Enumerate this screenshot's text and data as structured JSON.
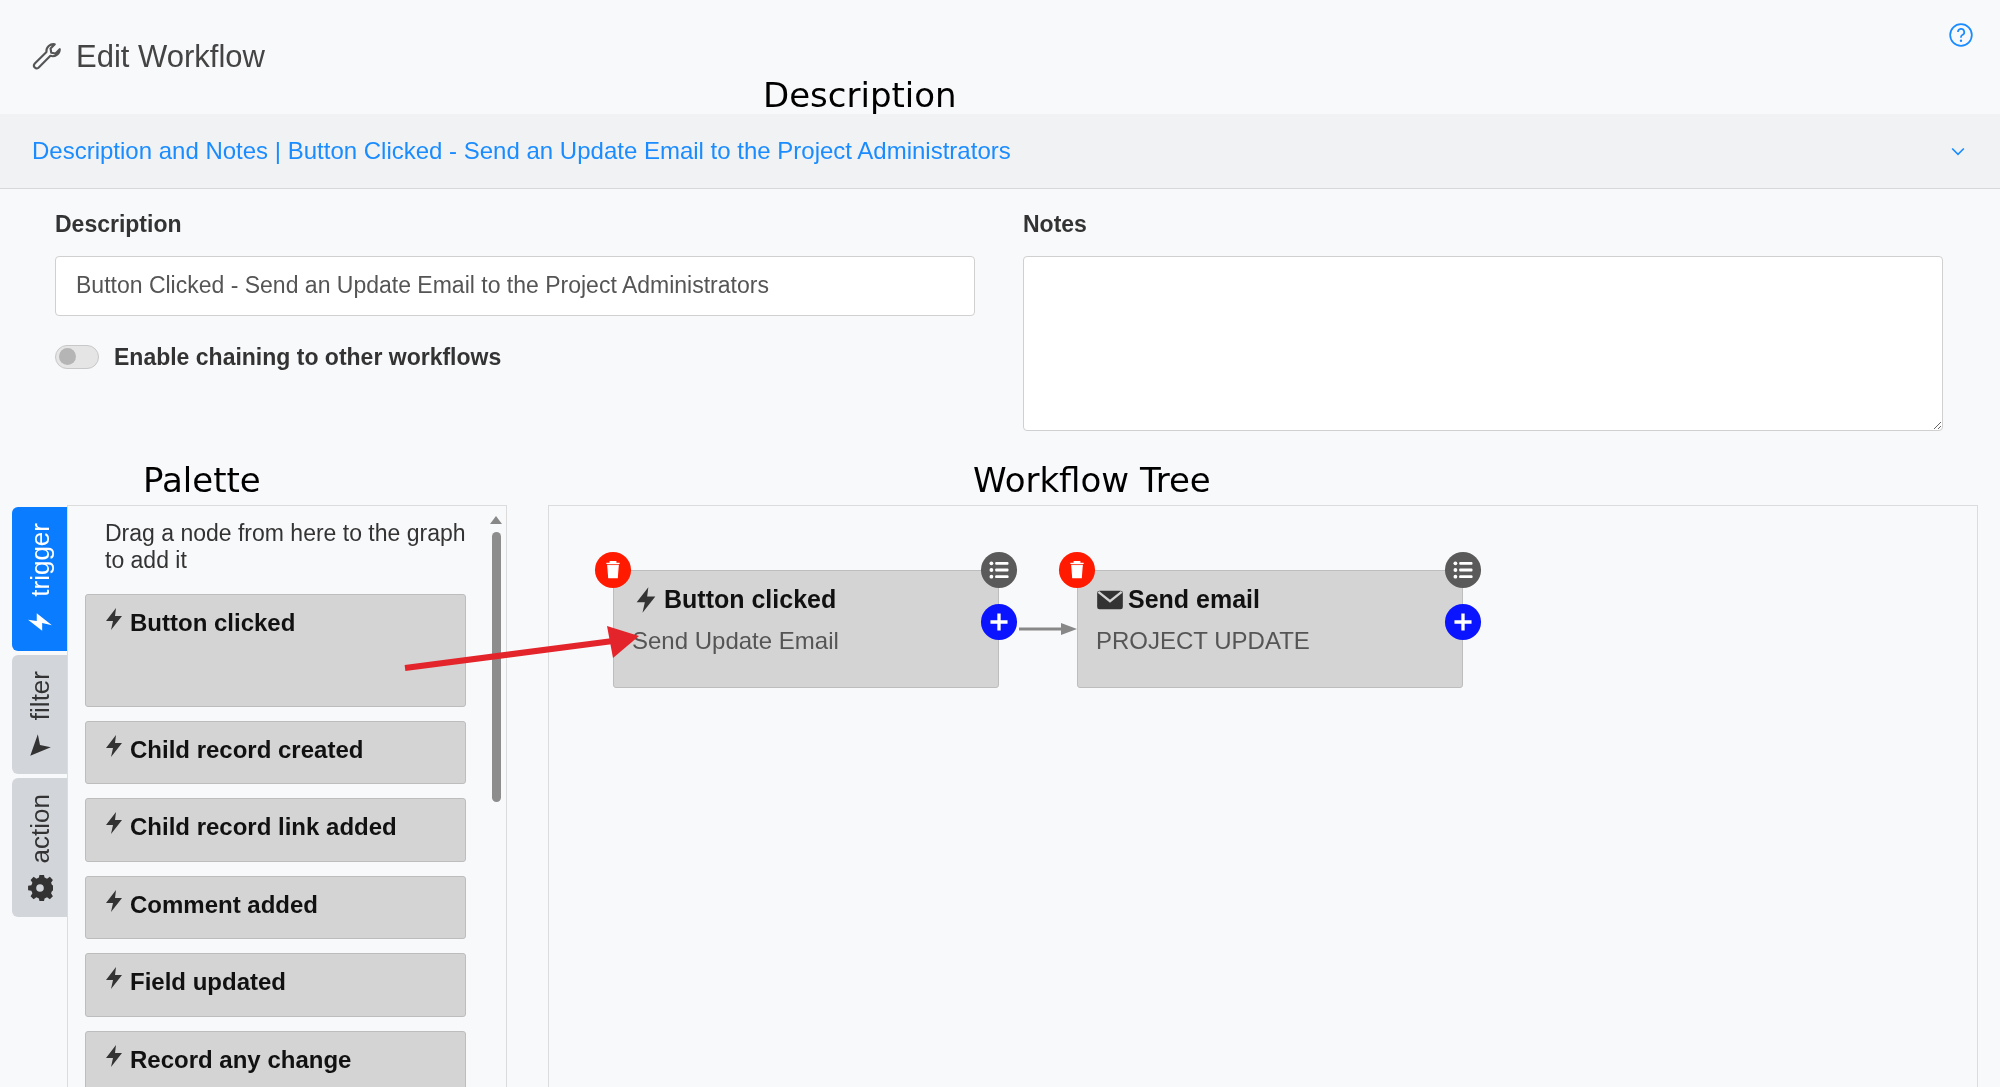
{
  "header": {
    "title": "Edit Workflow"
  },
  "annotation_description": "Description",
  "accordion": {
    "title": "Description and Notes | Button Clicked - Send an Update Email to the Project Administrators",
    "expanded": true
  },
  "form": {
    "description_label": "Description",
    "description_value": "Button Clicked - Send an Update Email to the Project Administrators",
    "chaining": {
      "label": "Enable chaining to other workflows",
      "on": false
    },
    "notes_label": "Notes"
  },
  "annotation_palette": "Palette",
  "annotation_tree": "Workflow Tree",
  "palette": {
    "tabs": [
      {
        "label": "trigger",
        "kind": "bolt",
        "selected": true
      },
      {
        "label": "filter",
        "kind": "filter",
        "selected": false
      },
      {
        "label": "action",
        "kind": "gear",
        "selected": false
      }
    ],
    "hint": "Drag a node from here to the graph to add it",
    "items": [
      {
        "label": "Button clicked"
      },
      {
        "label": "Child record created"
      },
      {
        "label": "Child record link added"
      },
      {
        "label": "Comment added"
      },
      {
        "label": "Field updated"
      },
      {
        "label": "Record any change"
      }
    ]
  },
  "workflow_tree": {
    "nodes": [
      {
        "kind": "trigger",
        "title": "Button clicked",
        "subtitle": "Send Update Email"
      },
      {
        "kind": "email",
        "title": "Send email",
        "subtitle": "PROJECT UPDATE"
      }
    ]
  }
}
